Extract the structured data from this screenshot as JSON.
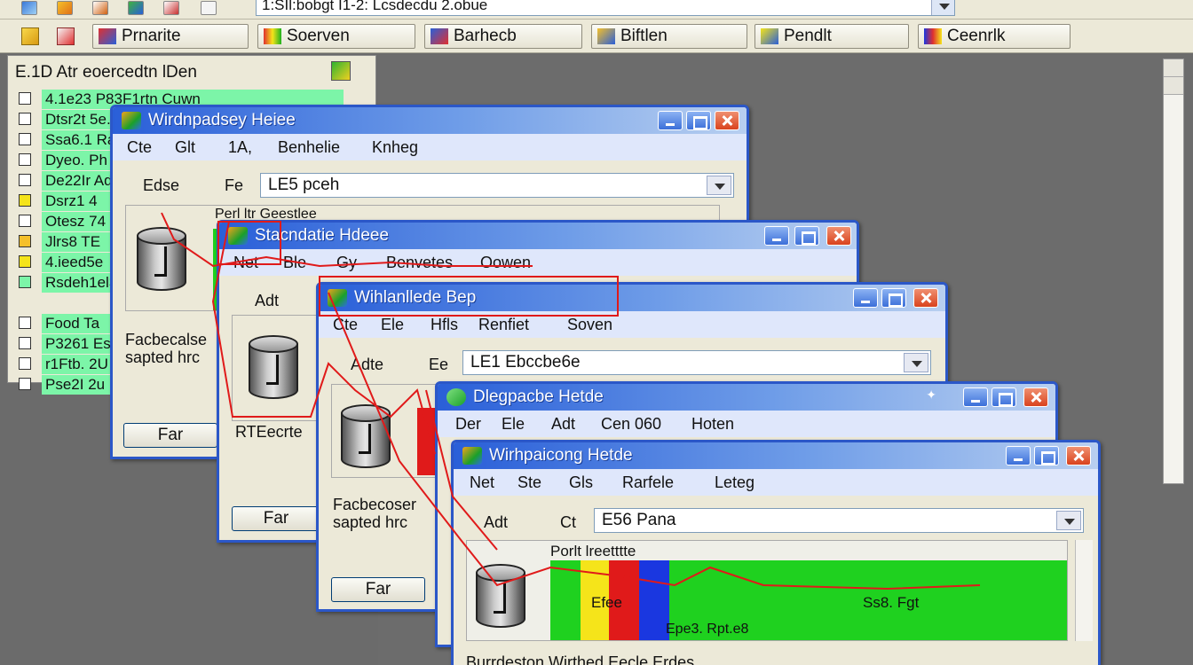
{
  "topbar": {
    "address": "1:SIl:bobgt     I1-2: Lcsdecdu 2.obue"
  },
  "launchbar": {
    "buttons": [
      {
        "label": "Prnarite"
      },
      {
        "label": "Soerven"
      },
      {
        "label": "Barhecb"
      },
      {
        "label": "Biftlen"
      },
      {
        "label": "Pendlt"
      },
      {
        "label": "Ceenrlk"
      }
    ]
  },
  "left_panel": {
    "title": "E.1D Atr eoercedtn lDen",
    "items": [
      "4.1e23 P83F1rtn   Cuwn",
      "Dtsr2t 5e.3 Rpt1",
      "Ssa6.1 Ran",
      "Dyeo. Ph",
      "De22Ir Ad",
      "Dsrz1 4",
      "Otesz 74",
      "Jlrs8 TE",
      "4.ieed5e",
      "Rsdeh1el3",
      "",
      "Food Ta",
      "P3261 Es",
      "r1Ftb. 2U",
      "Pse2I 2u"
    ]
  },
  "windows": [
    {
      "title": "Wirdnpadsey Heiee",
      "menu": [
        "Cte",
        "Glt",
        "1A,",
        "Benhelie",
        "Knheg"
      ],
      "field_label1": "Edse",
      "field_label2": "Fe",
      "combo_value": "LE5 pceh",
      "content_header": "Perl ltr Geestlee",
      "static_text": "Facbecalse\nsapted hrc",
      "button": "Far"
    },
    {
      "title": "Stacndatie Hdeee",
      "menu": [
        "Net",
        "Ble",
        "Gy",
        "Benvetes",
        "Oowen"
      ],
      "field_label1": "Adt",
      "static_text": "RTEecrte",
      "button": "Far"
    },
    {
      "title": "Wihlanllede Bep",
      "menu": [
        "Cte",
        "Ele",
        "Hfls",
        "Renfiet",
        "Soven"
      ],
      "field_label1": "Adte",
      "field_label2": "Ee",
      "combo_value": "LE1 Ebccbe6e",
      "static_text": "Facbecoser\nsapted hrc",
      "button": "Far"
    },
    {
      "title": "Dlegpacbe Hetde",
      "menu": [
        "Der",
        "Ele",
        "Adt",
        "Cen 060",
        "Hoten"
      ]
    },
    {
      "title": "Wirhpaicong Hetde",
      "menu": [
        "Net",
        "Ste",
        "Gls",
        "Rarfele",
        "Leteg"
      ],
      "field_label1": "Adt",
      "field_label2": "Ct",
      "combo_value": "E56 Pana",
      "content_header": "Porlt lreetttte",
      "bar_label1": "Efee",
      "bar_label2": "Ss8. Fgt",
      "bar_label3": "Epe3. Rpt.e8",
      "footer_text": "Burrdeston Wirthed Eecle Erdes"
    }
  ],
  "colors": {
    "titlebar_start": "#2a5fd8",
    "list_highlight": "#7cf5a8",
    "bar_green": "#1fd11f",
    "bar_yellow": "#f5e41a",
    "bar_red": "#e01a1a",
    "bar_blue": "#1a37e0",
    "annotation_red": "#e01a1a"
  }
}
